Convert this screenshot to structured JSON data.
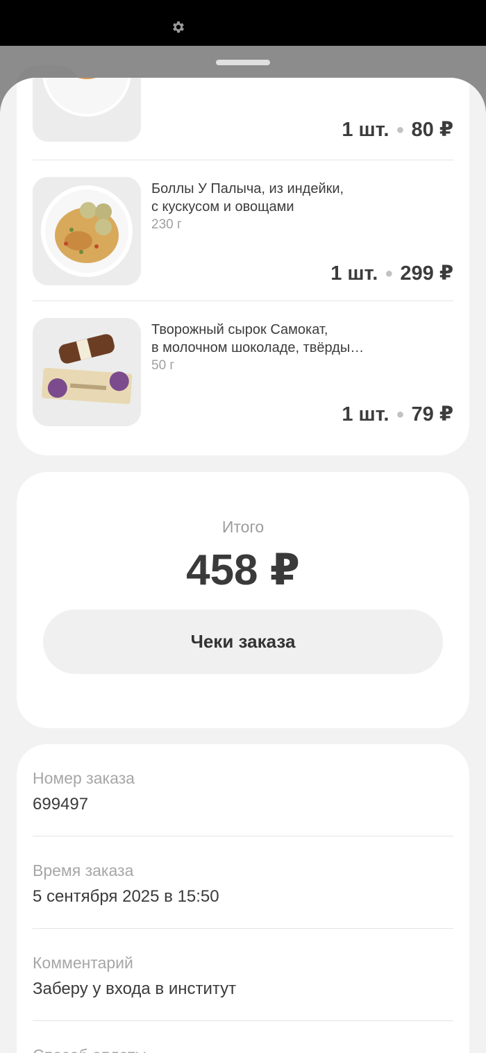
{
  "items": [
    {
      "name": "",
      "weight": "",
      "qty": "1 шт.",
      "price": "80 ₽",
      "image": "cheesecake-bun"
    },
    {
      "name": "Боллы У Палыча, из индейки,\nс кускусом и овощами",
      "weight": "230 г",
      "qty": "1 шт.",
      "price": "299 ₽",
      "image": "turkey-balls-couscous"
    },
    {
      "name": "Творожный сырок Самокат,\nв молочном шоколаде, твёрды…",
      "weight": "50 г",
      "qty": "1 шт.",
      "price": "79 ₽",
      "image": "curd-bar-chocolate"
    }
  ],
  "total": {
    "label": "Итого",
    "value": "458 ₽",
    "receipts_button": "Чеки заказа"
  },
  "info": {
    "order_number_label": "Номер заказа",
    "order_number": "699497",
    "order_time_label": "Время заказа",
    "order_time": "5 сентября 2025 в 15:50",
    "comment_label": "Комментарий",
    "comment": "Заберу у входа в институт",
    "payment_label": "Способ оплаты"
  },
  "icons": {
    "status": "gear-icon"
  },
  "colors": {
    "sheet_bg": "#f2f2f2",
    "card_bg": "#ffffff",
    "text": "#3a3a3a",
    "muted": "#a0a0a0"
  }
}
